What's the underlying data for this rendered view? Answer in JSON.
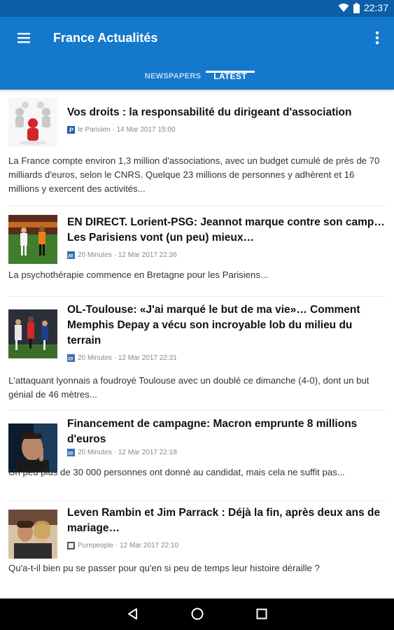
{
  "status": {
    "time": "22:37",
    "wifi_icon": "wifi-icon",
    "battery_icon": "battery-icon"
  },
  "appbar": {
    "title": "France Actualités",
    "menu_icon": "menu-icon",
    "more_icon": "more-vert-icon"
  },
  "tabs": [
    {
      "label": "NEWSPAPERS",
      "active": false
    },
    {
      "label": "LATEST",
      "active": true
    }
  ],
  "articles": [
    {
      "title": "Vos droits : la responsabilité du dirigeant d'association",
      "source": "le Parisien",
      "date": "14 Mar 2017 15:00",
      "summary": "La France compte environ 1,3 million d'associations, avec un budget cumulé de près de 70 milliards d'euros, selon le CNRS. Quelque 23 millions de personnes y adhèrent et 16 millions y exercent des activités..."
    },
    {
      "title": "EN DIRECT. Lorient-PSG: Jeannot marque contre son camp… Les Parisiens vont (un peu) mieux…",
      "source": "20 Minutes",
      "date": "12 Mar 2017 22:36",
      "summary": "La psychothérapie commence en Bretagne pour les Parisiens..."
    },
    {
      "title": "OL-Toulouse: «J'ai marqué le but de ma vie»… Comment Memphis Depay a vécu son incroyable lob du milieu du terrain",
      "source": "20 Minutes",
      "date": "12 Mar 2017 22:31",
      "summary": "L'attaquant lyonnais a foudroyé Toulouse avec un doublé ce dimanche (4-0), dont un but génial de 46 mètres..."
    },
    {
      "title": "Financement de campagne: Macron emprunte 8 millions d'euros",
      "source": "20 Minutes",
      "date": "12 Mar 2017 22:18",
      "summary": "Un peu plus de 30 000 personnes ont donné au candidat, mais cela ne suffit pas..."
    },
    {
      "title": "Leven Rambin et Jim Parrack : Déjà la fin, après deux ans de mariage…",
      "source": "Purepeople",
      "date": "12 Mar 2017 22:10",
      "summary": "Qu'a-t-il bien pu se passer pour qu'en si peu de temps leur histoire déraille ?"
    }
  ],
  "navbar": {
    "back_icon": "back-icon",
    "home_icon": "home-icon",
    "recents_icon": "recents-icon"
  },
  "colors": {
    "primary": "#1479cc",
    "status_bar": "#0a5fa8",
    "nav_bar": "#000000"
  }
}
